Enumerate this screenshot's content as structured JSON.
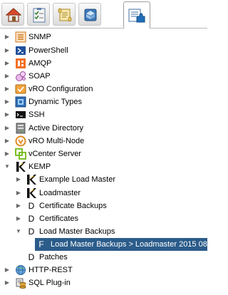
{
  "toolbar": {
    "buttons": [
      {
        "icon": "home-icon"
      },
      {
        "icon": "checklist-icon"
      },
      {
        "icon": "scroll-icon"
      },
      {
        "icon": "package-icon"
      },
      {
        "icon": "plugin-icon",
        "active": true
      }
    ]
  },
  "tree": {
    "items": [
      {
        "label": "SNMP",
        "icon": "snmp-icon"
      },
      {
        "label": "PowerShell",
        "icon": "powershell-icon"
      },
      {
        "label": "AMQP",
        "icon": "amqp-icon"
      },
      {
        "label": "SOAP",
        "icon": "soap-icon"
      },
      {
        "label": "vRO Configuration",
        "icon": "vro-configuration-icon"
      },
      {
        "label": "Dynamic Types",
        "icon": "dynamic-types-icon"
      },
      {
        "label": "SSH",
        "icon": "ssh-icon"
      },
      {
        "label": "Active Directory",
        "icon": "active-directory-icon"
      },
      {
        "label": "vRO Multi-Node",
        "icon": "vro-multi-node-icon"
      },
      {
        "label": "vCenter Server",
        "icon": "vcenter-server-icon"
      },
      {
        "label": "KEMP",
        "icon": "kemp-icon"
      },
      {
        "label": "Example Load Master",
        "icon": "kemp-icon"
      },
      {
        "label": "Loadmaster",
        "icon": "kemp-icon"
      },
      {
        "label": "Certificate Backups",
        "icon": "d-icon",
        "glyph": "D"
      },
      {
        "label": "Certificates",
        "icon": "d-icon",
        "glyph": "D"
      },
      {
        "label": "Load Master Backups",
        "icon": "d-icon",
        "glyph": "D"
      },
      {
        "label": "Load Master Backups > Loadmaster 2015 08",
        "icon": "f-icon",
        "glyph": "F"
      },
      {
        "label": "Patches",
        "icon": "d-icon",
        "glyph": "D"
      },
      {
        "label": "HTTP-REST",
        "icon": "http-rest-icon"
      },
      {
        "label": "SQL Plug-in",
        "icon": "sql-plugin-icon"
      }
    ]
  },
  "colors": {
    "selection": "#2b5c8a",
    "border": "#b9b9b9"
  }
}
